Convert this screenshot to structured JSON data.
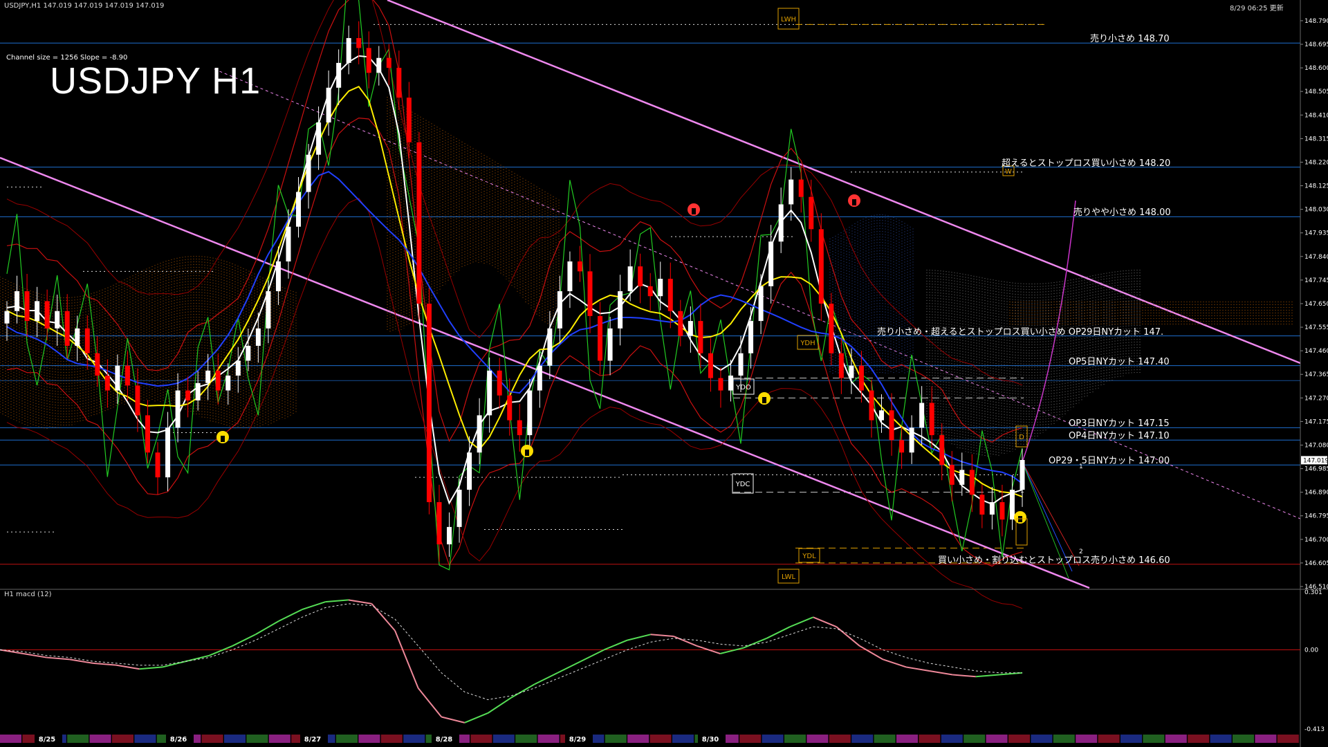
{
  "header": {
    "symbol_line": "USDJPY,H1 147.019 147.019 147.019 147.019",
    "timestamp": "8/29 06:25 更新"
  },
  "overlay_title": "USDJPY H1",
  "channel_info": "Channel size = 1256 Slope = -8.90",
  "macd_label": "H1  macd (12)",
  "annotations": [
    {
      "text": "売り小さめ 148.70",
      "price": 148.7
    },
    {
      "text": "超えるとストップロス買い小さめ 148.20",
      "price": 148.2
    },
    {
      "text": "売りやや小さめ 148.00",
      "price": 148.0
    },
    {
      "text": "売り小さめ・超えるとストップロス買い小さめ   OP29日NYカット 147.",
      "price": 147.52
    },
    {
      "text": "OP5日NYカット 147.40",
      "price": 147.4
    },
    {
      "text": "OP3日NYカット 147.15",
      "price": 147.15
    },
    {
      "text": "OP4日NYカット 147.10",
      "price": 147.1
    },
    {
      "text": "OP29・5日NYカット 147.00",
      "price": 147.0
    },
    {
      "text": "買い小さめ・割り込むとストップロス売り小さめ 146.60",
      "price": 146.6
    }
  ],
  "box_labels": [
    {
      "text": "LWH",
      "color": "#e0a000"
    },
    {
      "text": "YDH",
      "color": "#e0a000"
    },
    {
      "text": "YDO",
      "color": "#ffffff"
    },
    {
      "text": "YDC",
      "color": "#ffffff"
    },
    {
      "text": "YDL",
      "color": "#e0a000"
    },
    {
      "text": "LWL",
      "color": "#e0a000"
    },
    {
      "text": "D",
      "color": "#e0a000"
    },
    {
      "text": "W",
      "color": "#e0a000"
    }
  ],
  "projection_labels": [
    "1",
    "2"
  ],
  "colors": {
    "background": "#000000",
    "bull_candle": "#ffffff",
    "bear_candle": "#ff0000",
    "grid_blue": "#1e6fd0",
    "channel_pink": "#ee88ee",
    "ma_white": "#ffffff",
    "ma_yellow": "#ffee00",
    "ma_blue": "#2040ff",
    "bollinger_red": "#cc1010",
    "rsi_green": "#22cc22",
    "cloud_orange": "#c86400",
    "cloud_blue": "#3050b0",
    "macd_main": "#55dd55",
    "macd_neg": "#ee8899",
    "macd_signal": "#dddddd"
  },
  "chart_data": [
    {
      "type": "candlestick",
      "title": "USDJPY H1",
      "ylim": [
        146.51,
        148.84
      ],
      "yticks": [
        "148.790",
        "148.695",
        "148.600",
        "148.505",
        "148.410",
        "148.315",
        "148.220",
        "148.125",
        "148.030",
        "147.935",
        "147.840",
        "147.745",
        "147.650",
        "147.555",
        "147.460",
        "147.365",
        "147.270",
        "147.175",
        "147.080",
        "146.985",
        "146.890",
        "146.795",
        "146.700",
        "146.605",
        "146.510"
      ],
      "current_price_label": "147.019",
      "x_date_labels": [
        "8/25",
        "8/26",
        "8/27",
        "8/28",
        "8/29",
        "8/30"
      ],
      "horizontal_levels": [
        148.7,
        148.2,
        148.0,
        147.52,
        147.4,
        147.15,
        147.1,
        147.0
      ],
      "red_level": 146.6,
      "close_series": [
        147.62,
        147.7,
        147.58,
        147.66,
        147.55,
        147.62,
        147.48,
        147.55,
        147.45,
        147.36,
        147.3,
        147.4,
        147.32,
        147.2,
        147.05,
        146.95,
        147.15,
        147.3,
        147.26,
        147.33,
        147.38,
        147.3,
        147.36,
        147.42,
        147.48,
        147.55,
        147.7,
        147.82,
        147.96,
        148.1,
        148.25,
        148.38,
        148.52,
        148.62,
        148.72,
        148.68,
        148.58,
        148.64,
        148.6,
        148.48,
        148.3,
        147.65,
        146.85,
        146.68,
        146.75,
        146.9,
        147.05,
        147.2,
        147.38,
        147.28,
        147.18,
        147.12,
        147.3,
        147.4,
        147.55,
        147.7,
        147.82,
        147.78,
        147.6,
        147.42,
        147.55,
        147.7,
        147.8,
        147.72,
        147.68,
        147.75,
        147.62,
        147.52,
        147.58,
        147.45,
        147.35,
        147.3,
        147.36,
        147.45,
        147.58,
        147.72,
        147.9,
        148.05,
        148.15,
        148.08,
        147.95,
        147.65,
        147.45,
        147.35,
        147.4,
        147.3,
        147.18,
        147.22,
        147.1,
        147.05,
        147.15,
        147.25,
        147.12,
        147.0,
        146.92,
        146.98,
        146.88,
        146.8,
        146.85,
        146.78,
        146.9,
        147.02
      ],
      "candles_summary": "hourly candles 8/25 to 8/29"
    },
    {
      "type": "line",
      "title": "H1  macd (12)",
      "ylim": [
        -0.413,
        0.301
      ],
      "yticks": [
        "0.301",
        "0.00",
        "-0.413"
      ],
      "series": [
        {
          "values": [
            0.0,
            -0.02,
            -0.04,
            -0.05,
            -0.07,
            -0.08,
            -0.1,
            -0.09,
            -0.06,
            -0.03,
            0.02,
            0.08,
            0.15,
            0.21,
            0.25,
            0.26,
            0.24,
            0.1,
            -0.2,
            -0.35,
            -0.38,
            -0.33,
            -0.25,
            -0.18,
            -0.12,
            -0.06,
            0.0,
            0.05,
            0.08,
            0.07,
            0.02,
            -0.02,
            0.01,
            0.06,
            0.12,
            0.17,
            0.12,
            0.02,
            -0.05,
            -0.09,
            -0.11,
            -0.13,
            -0.14,
            -0.13,
            -0.12
          ]
        },
        {
          "values": [
            0.0,
            -0.01,
            -0.03,
            -0.04,
            -0.06,
            -0.07,
            -0.08,
            -0.08,
            -0.06,
            -0.04,
            0.0,
            0.05,
            0.11,
            0.17,
            0.22,
            0.24,
            0.23,
            0.16,
            0.02,
            -0.12,
            -0.22,
            -0.26,
            -0.24,
            -0.2,
            -0.15,
            -0.1,
            -0.05,
            0.0,
            0.04,
            0.06,
            0.05,
            0.03,
            0.02,
            0.04,
            0.08,
            0.12,
            0.11,
            0.06,
            0.0,
            -0.04,
            -0.07,
            -0.09,
            -0.11,
            -0.12,
            -0.12
          ]
        }
      ]
    }
  ]
}
